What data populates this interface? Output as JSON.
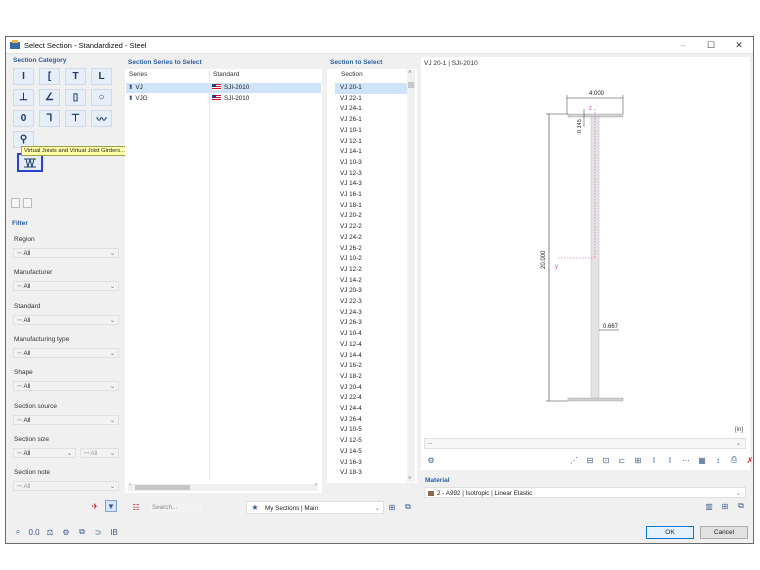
{
  "window": {
    "title": "Select Section - Standardized - Steel",
    "controls": [
      "–",
      "☐",
      "✕"
    ]
  },
  "section_category": {
    "title": "Section Category",
    "buttons": [
      {
        "name": "i-section-icon",
        "glyph": "I"
      },
      {
        "name": "channel-icon",
        "glyph": "["
      },
      {
        "name": "t-section-icon",
        "glyph": "T"
      },
      {
        "name": "angle-icon",
        "glyph": "L"
      },
      {
        "name": "inverted-t-icon",
        "glyph": "⊥"
      },
      {
        "name": "unequal-angle-icon",
        "glyph": "∠"
      },
      {
        "name": "rectangular-tube-icon",
        "glyph": "▯"
      },
      {
        "name": "round-tube-icon",
        "glyph": "○"
      },
      {
        "name": "round-bar-icon",
        "glyph": "0"
      },
      {
        "name": "z-section-icon",
        "glyph": "Ꞁ"
      },
      {
        "name": "rail-icon",
        "glyph": "⊤"
      },
      {
        "name": "sheet-pile-icon",
        "glyph": "〰"
      },
      {
        "name": "bulb-icon",
        "glyph": "⚲"
      }
    ],
    "selected_icon": "joist-icon",
    "tooltip": "Virtual Joists and Virtual Joist Girders..."
  },
  "filter": {
    "title": "Filter",
    "fields": [
      {
        "label": "Region",
        "value": "All"
      },
      {
        "label": "Manufacturer",
        "value": "All"
      },
      {
        "label": "Standard",
        "value": "All"
      },
      {
        "label": "Manufacturing type",
        "value": "All"
      },
      {
        "label": "Shape",
        "value": "All"
      },
      {
        "label": "Section source",
        "value": "All"
      },
      {
        "label": "Section size",
        "value": "All",
        "value2": "All"
      },
      {
        "label": "Section note",
        "value": "All"
      }
    ]
  },
  "series_panel": {
    "title": "Section Series to Select",
    "columns": [
      "Series",
      "Standard"
    ],
    "rows": [
      {
        "series": "VJ",
        "standard": "SJI-2010"
      },
      {
        "series": "VJG",
        "standard": "SJI-2010"
      }
    ]
  },
  "section_panel": {
    "title": "Section to Select",
    "column": "Section",
    "items": [
      "VJ 20-1",
      "VJ 22-1",
      "VJ 24-1",
      "VJ 26-1",
      "VJ 10-1",
      "VJ 12-1",
      "VJ 14-1",
      "VJ 10-3",
      "VJ 12-3",
      "VJ 14-3",
      "VJ 16-1",
      "VJ 18-1",
      "VJ 20-2",
      "VJ 22-2",
      "VJ 24-2",
      "VJ 26-2",
      "VJ 10-2",
      "VJ 12-2",
      "VJ 14-2",
      "VJ 20-3",
      "VJ 22-3",
      "VJ 24-3",
      "VJ 26-3",
      "VJ 10-4",
      "VJ 12-4",
      "VJ 14-4",
      "VJ 16-2",
      "VJ 18-2",
      "VJ 20-4",
      "VJ 22-4",
      "VJ 24-4",
      "VJ 26-4",
      "VJ 10-5",
      "VJ 12-5",
      "VJ 14-5",
      "VJ 16-3",
      "VJ 18-3"
    ]
  },
  "preview": {
    "title": "VJ 20-1 | SJI-2010",
    "dim_width": "4.000",
    "dim_flange": "0.145",
    "dim_height": "20.000",
    "dim_web": "0.667",
    "axis_z": "z",
    "axis_y": "y",
    "unit": "[in]",
    "dropdown_value": "--"
  },
  "material": {
    "title": "Material",
    "value": "2 - A992 | Isotropic | Linear Elastic"
  },
  "bottom": {
    "search_placeholder": "Search...",
    "my_sections": "My Sections | Main",
    "ok": "OK",
    "cancel": "Cancel"
  },
  "colors": {
    "accent": "#2a5f9e",
    "selection": "#cfe4f8",
    "highlight_border": "#2a3fd6",
    "tooltip_bg": "#ffffa8"
  }
}
